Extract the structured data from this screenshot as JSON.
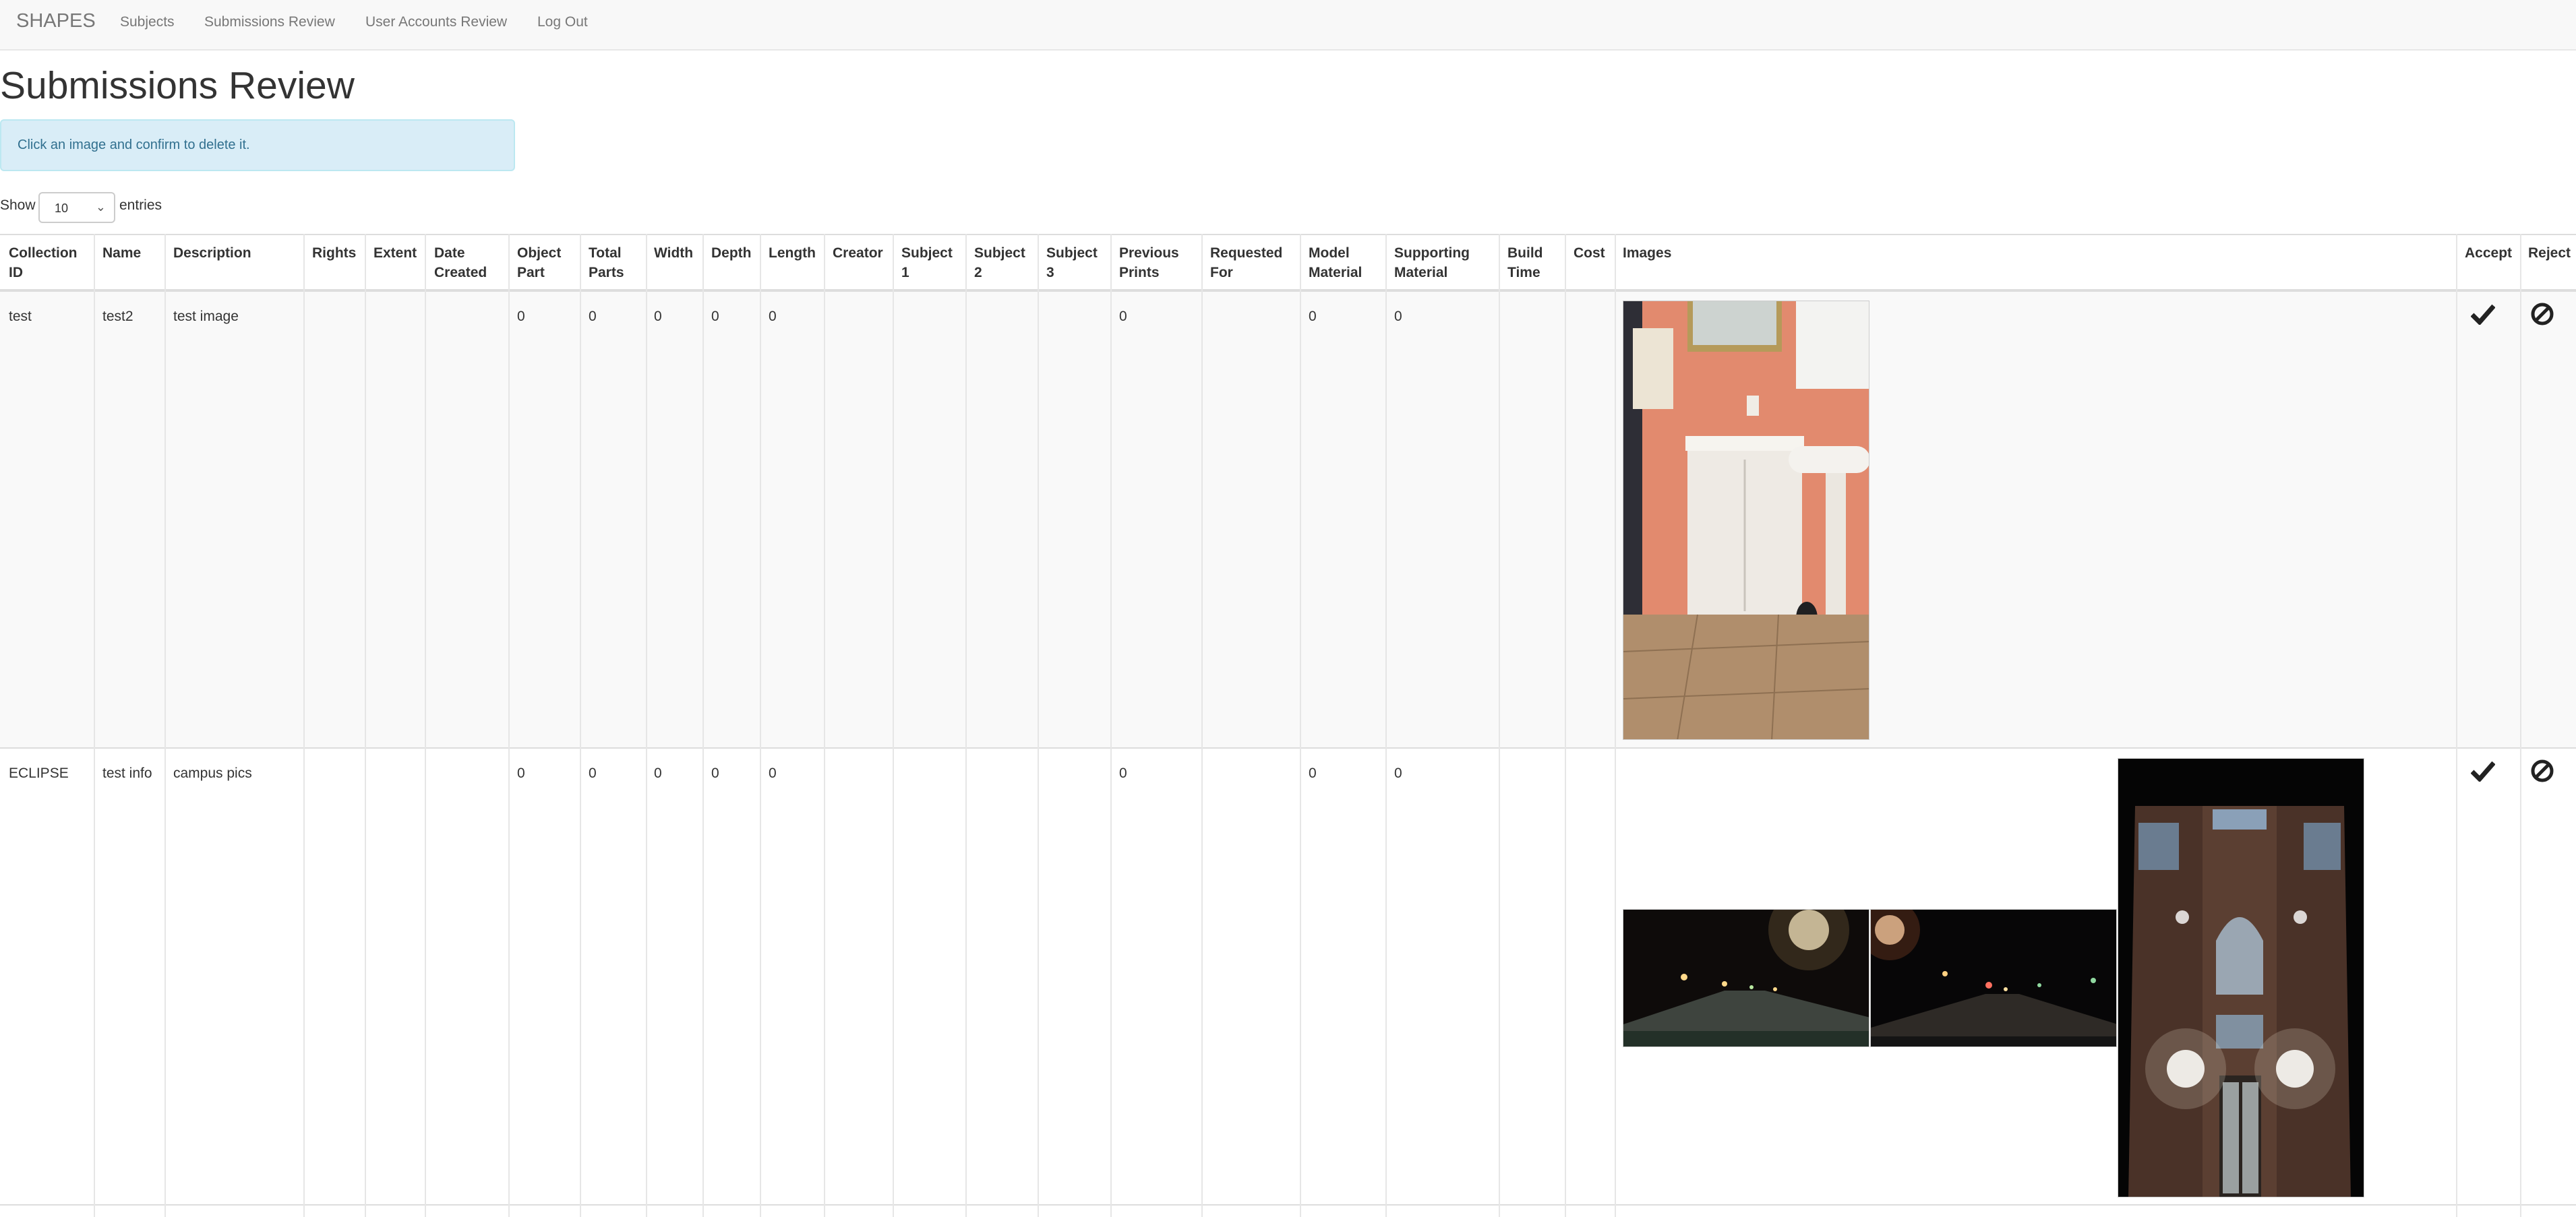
{
  "nav": {
    "brand": "SHAPES",
    "links": [
      "Subjects",
      "Submissions Review",
      "User Accounts Review",
      "Log Out"
    ]
  },
  "page": {
    "title": "Submissions Review",
    "alert": "Click an image and confirm to delete it."
  },
  "length_menu": {
    "show_label": "Show",
    "selected": "10",
    "entries_label": "entries"
  },
  "table": {
    "columns": [
      "Collection\nID",
      "Name",
      "Description",
      "Rights",
      "Extent",
      "Date\nCreated",
      "Object\nPart",
      "Total\nParts",
      "Width",
      "Depth",
      "Length",
      "Creator",
      "Subject\n1",
      "Subject\n2",
      "Subject\n3",
      "Previous\nPrints",
      "Requested\nFor",
      "Model\nMaterial",
      "Supporting\nMaterial",
      "Build\nTime",
      "Cost",
      "Images",
      "Accept",
      "Reject"
    ],
    "rows": [
      {
        "cells": [
          "test",
          "test2",
          "test image",
          "",
          "",
          "",
          "0",
          "0",
          "0",
          "0",
          "0",
          "",
          "",
          "",
          "",
          "0",
          "",
          "0",
          "0",
          "",
          ""
        ],
        "images": [
          "bathroom-photo"
        ]
      },
      {
        "cells": [
          "ECLIPSE",
          "test info",
          "campus pics",
          "",
          "",
          "",
          "0",
          "0",
          "0",
          "0",
          "0",
          "",
          "",
          "",
          "",
          "0",
          "",
          "0",
          "0",
          "",
          ""
        ],
        "images": [
          "night-road-photo-1",
          "night-road-photo-2",
          "night-building-photo"
        ]
      }
    ]
  },
  "icons": {
    "accept": "checkmark-icon",
    "reject": "ban-icon"
  },
  "colors": {
    "navbar_bg": "#f8f8f8",
    "alert_bg": "#d9edf7",
    "alert_text": "#31708f",
    "stripe": "#f9f9f9"
  }
}
